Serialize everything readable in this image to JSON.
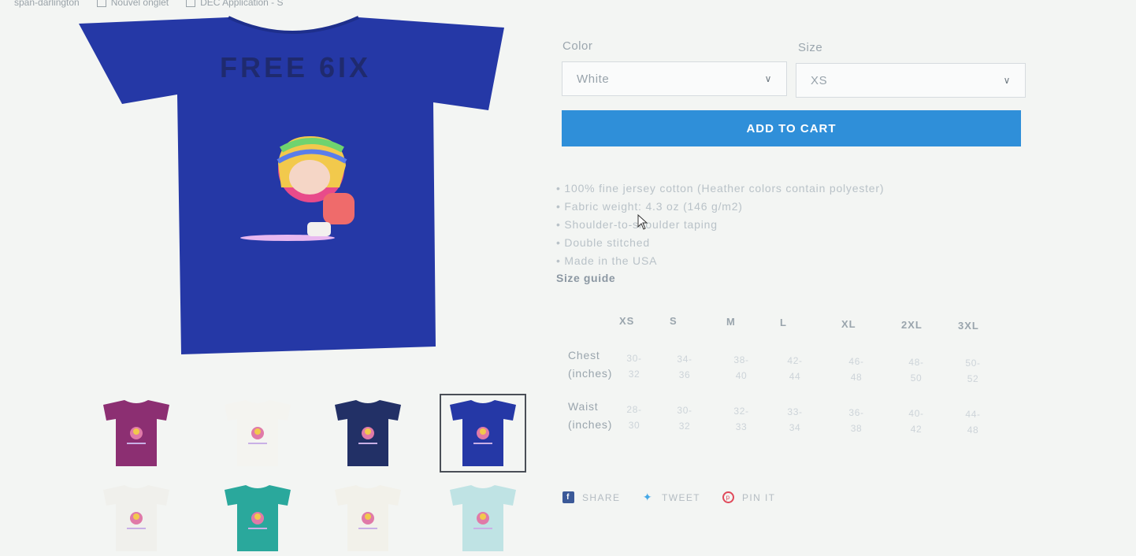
{
  "browser": {
    "bookmarks": [
      {
        "label": "span-darlington"
      },
      {
        "label": "Nouvel onglet"
      },
      {
        "label": "DEC Application - S"
      }
    ]
  },
  "product": {
    "main_image": {
      "color_hex": "#2538a6",
      "print_text": "FREE 6IX"
    },
    "thumbnails": [
      {
        "color_hex": "#8c2f72",
        "selected": false
      },
      {
        "color_hex": "#f4f4f0",
        "selected": false
      },
      {
        "color_hex": "#223066",
        "selected": false
      },
      {
        "color_hex": "#2538a6",
        "selected": true
      },
      {
        "color_hex": "#f0f0ec",
        "selected": false
      },
      {
        "color_hex": "#2aa89c",
        "selected": false
      },
      {
        "color_hex": "#f2f1ea",
        "selected": false
      },
      {
        "color_hex": "#bfe3e4",
        "selected": false
      }
    ]
  },
  "options": {
    "color_label": "Color",
    "color_value": "White",
    "size_label": "Size",
    "size_value": "XS"
  },
  "cart": {
    "button_label": "ADD TO CART",
    "button_color": "#2f8fd9"
  },
  "features": [
    "100% fine jersey cotton (Heather colors contain polyester)",
    "Fabric weight: 4.3 oz (146 g/m2)",
    "Shoulder-to-shoulder taping",
    "Double stitched",
    "Made in the USA"
  ],
  "size_guide": {
    "title": "Size guide",
    "sizes": [
      "XS",
      "S",
      "M",
      "L",
      "XL",
      "2XL",
      "3XL"
    ],
    "rows": [
      {
        "label_1": "Chest",
        "label_2": "(inches)",
        "values": [
          [
            "30-",
            "32"
          ],
          [
            "34-",
            "36"
          ],
          [
            "38-",
            "40"
          ],
          [
            "42-",
            "44"
          ],
          [
            "46-",
            "48"
          ],
          [
            "48-",
            "50"
          ],
          [
            "50-",
            "52"
          ]
        ]
      },
      {
        "label_1": "Waist",
        "label_2": "(inches)",
        "values": [
          [
            "28-",
            "30"
          ],
          [
            "30-",
            "32"
          ],
          [
            "32-",
            "33"
          ],
          [
            "33-",
            "34"
          ],
          [
            "36-",
            "38"
          ],
          [
            "40-",
            "42"
          ],
          [
            "44-",
            "48"
          ]
        ]
      }
    ]
  },
  "share": {
    "facebook": {
      "icon": "facebook-icon",
      "label": "SHARE"
    },
    "twitter": {
      "icon": "twitter-icon",
      "label": "TWEET"
    },
    "pinterest": {
      "icon": "pinterest-icon",
      "label": "PIN IT"
    }
  }
}
